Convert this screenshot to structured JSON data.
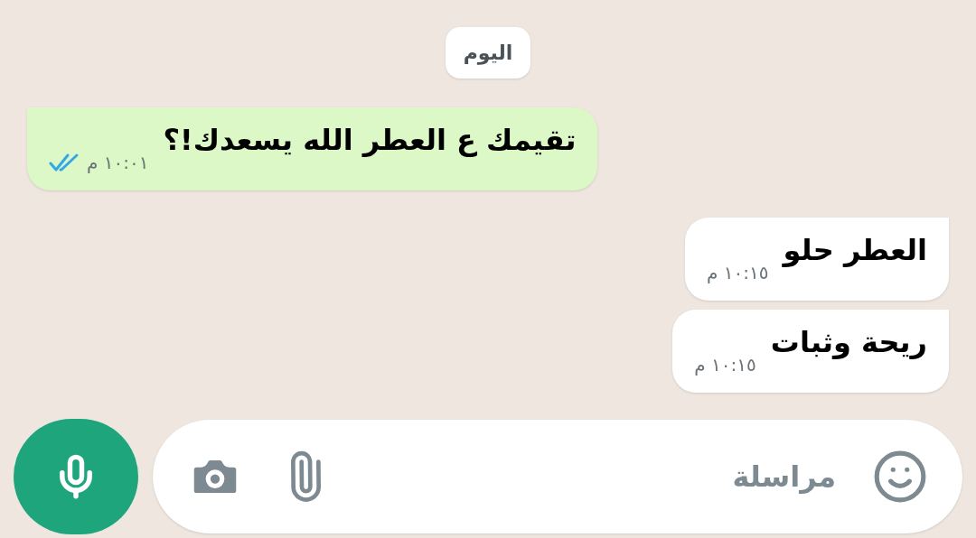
{
  "date_chip": "اليوم",
  "messages": [
    {
      "kind": "outgoing",
      "text": "تقيمك ع العطر الله يسعدك!؟",
      "time": "١٠:٠١ م",
      "read": true
    },
    {
      "kind": "incoming",
      "text": "العطر حلو",
      "time": "١٠:١٥ م"
    },
    {
      "kind": "incoming",
      "text": "ريحة وثبات",
      "time": "١٠:١٥ م"
    }
  ],
  "composer": {
    "placeholder": "مراسلة"
  }
}
